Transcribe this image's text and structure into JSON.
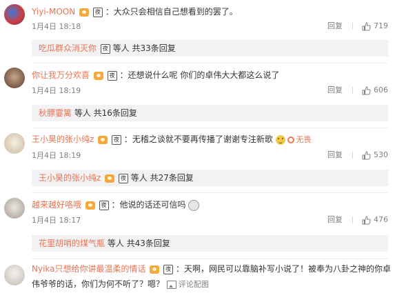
{
  "comments": [
    {
      "username": "Yiyi-MOON",
      "colon": "：",
      "text": "大众只会相信自己想看到的罢了。",
      "time": "1月4日 18:18",
      "reply_label": "回复",
      "likes": "719",
      "replies": {
        "who": "吃瓜群众消灭你",
        "suffix": "等人 共33条回复"
      }
    },
    {
      "username": "你让我万分欢喜",
      "colon": "：",
      "text": "还想说什么呢 你们的卓伟大大都这么说了",
      "time": "1月4日 18:19",
      "reply_label": "回复",
      "likes": "606",
      "replies": {
        "who": "秋膘霎篱",
        "suffix": "等人 共16条回复"
      }
    },
    {
      "username": "王小昊的张小纯z",
      "colon": "：",
      "text": "无稽之谈就不要再传播了谢谢专注新歌",
      "wuliao": "无畏",
      "time": "1月4日 18:19",
      "reply_label": "回复",
      "likes": "530",
      "replies": {
        "who": "王小昊的张小纯z",
        "suffix": "等人 共27条回复"
      }
    },
    {
      "username": "越来越好咯哦",
      "colon": "：",
      "text": "他说的话还可信吗",
      "time": "1月4日 18:17",
      "reply_label": "回复",
      "likes": "476",
      "replies": {
        "who": "花里胡哨的煤气瓶",
        "suffix": "等人 共43条回复"
      }
    },
    {
      "username": "Nyika只想给你讲最温柔的情话",
      "colon": "：",
      "text": "天啊，网民可以靠脑补写小说了！被奉为八卦之神的你卓",
      "text2": "伟爷爷的话，你们为何不听了？嗯？",
      "view_pic": "评论配图"
    }
  ],
  "badge_text": "夜",
  "colors": {
    "accent": "#eb7350",
    "meta": "#808080",
    "reply_bg": "#f2f2f5"
  }
}
